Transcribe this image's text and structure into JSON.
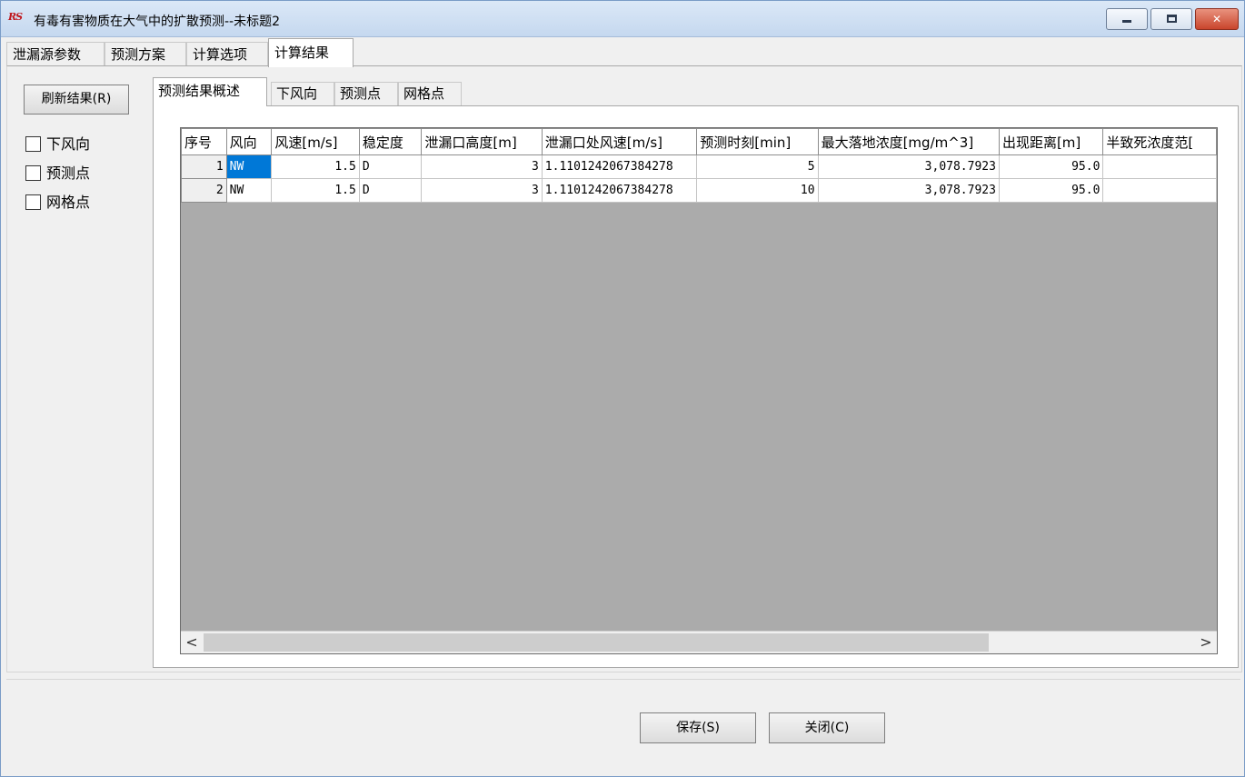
{
  "window": {
    "app_icon_text": "RS",
    "title": "有毒有害物质在大气中的扩散预测--未标题2"
  },
  "main_tabs": [
    {
      "label": "泄漏源参数"
    },
    {
      "label": "预测方案"
    },
    {
      "label": "计算选项"
    },
    {
      "label": "计算结果"
    }
  ],
  "left_panel": {
    "refresh_label": "刷新结果(R)",
    "checkboxes": [
      {
        "label": "下风向",
        "checked": false
      },
      {
        "label": "预测点",
        "checked": false
      },
      {
        "label": "网格点",
        "checked": false
      }
    ]
  },
  "sub_tabs": [
    {
      "label": "预测结果概述"
    },
    {
      "label": "下风向"
    },
    {
      "label": "预测点"
    },
    {
      "label": "网格点"
    }
  ],
  "table": {
    "columns": [
      "序号",
      "风向",
      "风速[m/s]",
      "稳定度",
      "泄漏口高度[m]",
      "泄漏口处风速[m/s]",
      "预测时刻[min]",
      "最大落地浓度[mg/m^3]",
      "出现距离[m]",
      "半致死浓度范["
    ],
    "rows": [
      [
        "1",
        "NW",
        "1.5",
        "D",
        "3",
        "1.1101242067384278",
        "5",
        "3,078.7923",
        "95.0",
        ""
      ],
      [
        "2",
        "NW",
        "1.5",
        "D",
        "3",
        "1.1101242067384278",
        "10",
        "3,078.7923",
        "95.0",
        ""
      ]
    ]
  },
  "scroll": {
    "left_arrow": "<",
    "right_arrow": ">"
  },
  "buttons": {
    "save_label": "保存(S)",
    "close_label": "关闭(C)"
  }
}
